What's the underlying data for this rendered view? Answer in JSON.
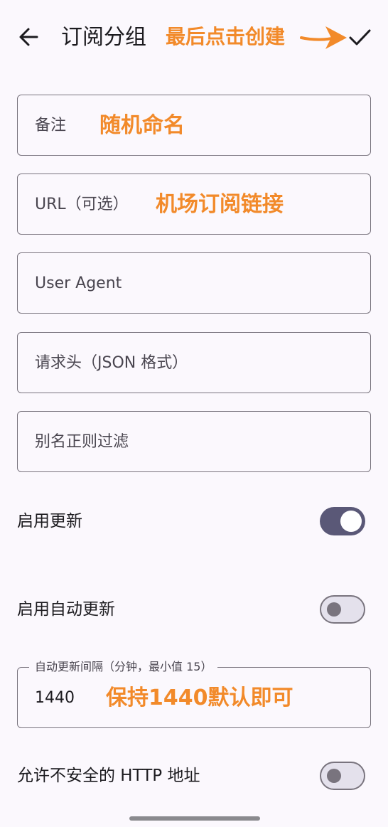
{
  "header": {
    "title": "订阅分组",
    "annotation": "最后点击创建"
  },
  "fields": {
    "remark": {
      "placeholder": "备注",
      "annotation": "随机命名"
    },
    "url": {
      "placeholder": "URL（可选）",
      "annotation": "机场订阅链接"
    },
    "user_agent": {
      "placeholder": "User Agent"
    },
    "headers": {
      "placeholder": "请求头（JSON 格式）"
    },
    "alias_filter": {
      "placeholder": "别名正则过滤"
    },
    "interval": {
      "label": "自动更新间隔（分钟，最小值 15）",
      "value": "1440",
      "annotation": "保持1440默认即可"
    }
  },
  "toggles": {
    "enable_update": {
      "label": "启用更新",
      "on": true
    },
    "auto_update": {
      "label": "启用自动更新",
      "on": false
    },
    "insecure_http": {
      "label": "允许不安全的 HTTP 地址",
      "on": false
    }
  },
  "colors": {
    "annotation": "#f28a2a",
    "switch_on_track": "#5a5877",
    "outline": "#79747e",
    "background": "#fbf8fd"
  },
  "icons": {
    "back": "arrow-left-icon",
    "confirm": "check-icon",
    "annotation_arrow": "arrow-right-icon"
  }
}
